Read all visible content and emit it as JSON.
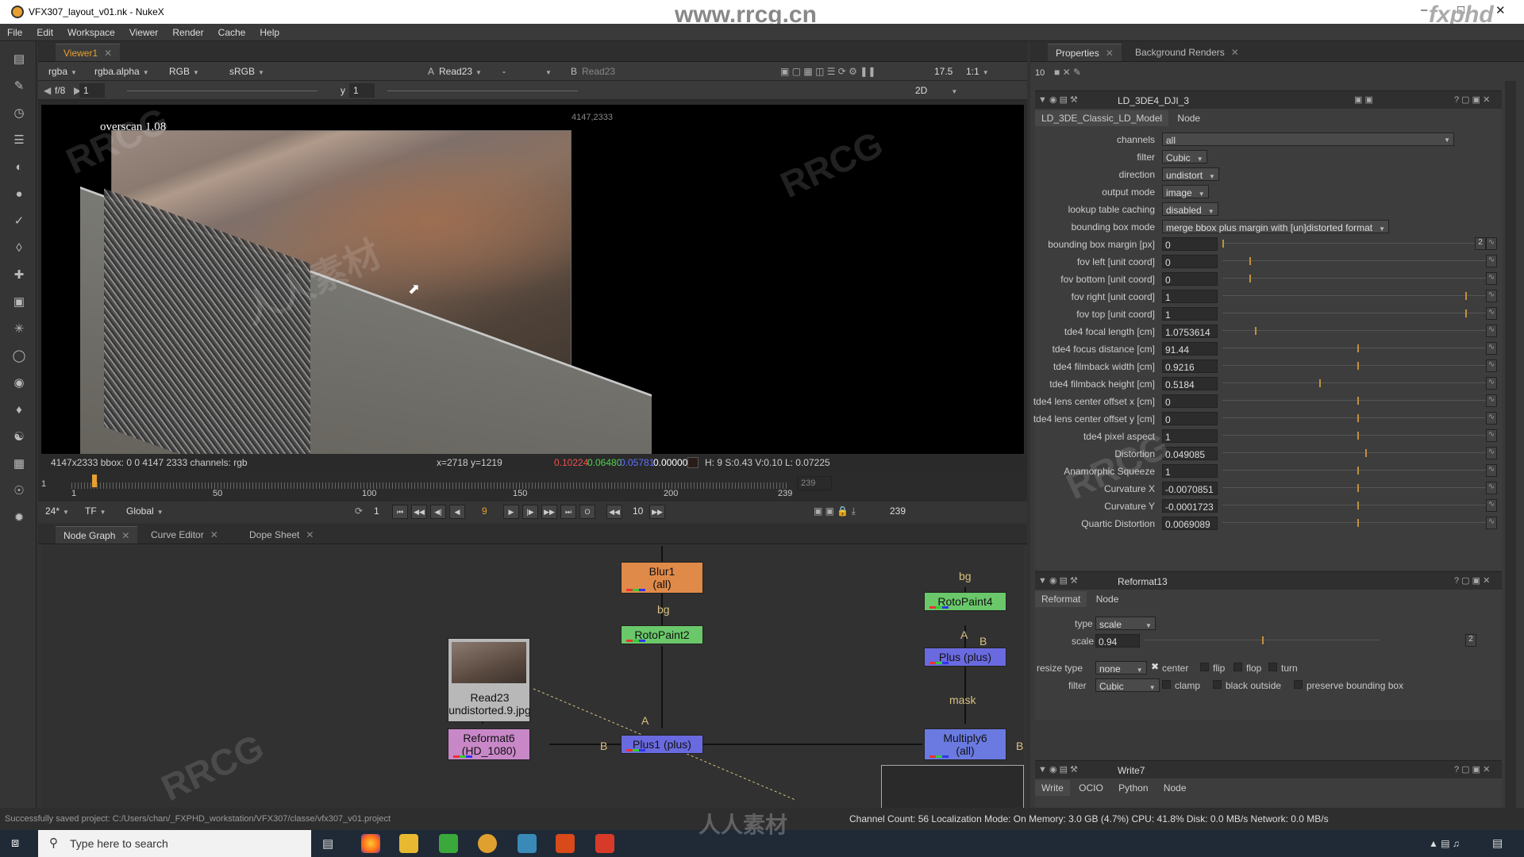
{
  "window": {
    "title": "VFX307_layout_v01.nk - NukeX"
  },
  "menu": [
    "File",
    "Edit",
    "Workspace",
    "Viewer",
    "Render",
    "Cache",
    "Help"
  ],
  "viewer": {
    "tab": "Viewer1",
    "channels": "rgba",
    "alpha": "rgba.alpha",
    "display": "RGB",
    "lut": "sRGB",
    "input_a_label": "A",
    "input_a": "Read23",
    "wipe": "-",
    "input_b_label": "B",
    "input_b": "Read23",
    "fstop": "f/8",
    "frame_field": "1",
    "y_label": "y",
    "y_field": "1",
    "zoom": "17.5",
    "ratio": "1:1",
    "mode2d": "2D",
    "overscan_text": "overscan 1.08",
    "bbox_corner": "4147,2333",
    "info_format": "4147x2333  bbox: 0 0 4147 2333 channels: rgb",
    "info_coords": "x=2718 y=1219",
    "info_r": "0.10224",
    "info_g": "0.06480",
    "info_b": "0.05781",
    "info_a": "0.00000",
    "info_hsvl": "H:  9 S:0.43 V:0.10  L: 0.07225",
    "tl_labels": [
      "1",
      "50",
      "100",
      "150",
      "200",
      "239"
    ],
    "tl_start": "1",
    "tl_end_box": "239",
    "fps": "24*",
    "tf": "TF",
    "global": "Global",
    "play_in": "1",
    "current_frame": "9",
    "step": "10",
    "play_out": "239"
  },
  "nodegraph": {
    "tabs": [
      "Node Graph",
      "Curve Editor",
      "Dope Sheet"
    ],
    "nodes": {
      "blur1": "Blur1",
      "blur1_sub": "(all)",
      "roto2": "RotoPaint2",
      "roto4": "RotoPaint4",
      "read23": "Read23",
      "read23_sub": "undistorted.9.jpg",
      "reformat6": "Reformat6",
      "reformat6_sub": "(HD_1080)",
      "plus1": "Plus1 (plus)",
      "plus": "Plus (plus)",
      "multiply6": "Multiply6",
      "multiply6_sub": "(all)"
    },
    "edge_labels": {
      "bg1": "bg",
      "bg2": "bg",
      "a1": "A",
      "a2": "A",
      "b1": "B",
      "b2": "B",
      "b3": "B",
      "mask": "mask"
    }
  },
  "properties": {
    "tabs": [
      "Properties",
      "Background Renders"
    ],
    "max_panels": "10",
    "ld": {
      "name": "LD_3DE4_DJI_3",
      "subtabs": [
        "LD_3DE_Classic_LD_Model",
        "Node"
      ],
      "rows": [
        {
          "label": "channels",
          "value": "all",
          "kind": "dd_wide"
        },
        {
          "label": "filter",
          "value": "Cubic",
          "kind": "dd"
        },
        {
          "label": "direction",
          "value": "undistort",
          "kind": "dd"
        },
        {
          "label": "output mode",
          "value": "image",
          "kind": "dd"
        },
        {
          "label": "lookup table caching",
          "value": "disabled",
          "kind": "dd"
        },
        {
          "label": "bounding box mode",
          "value": "merge bbox plus margin with [un]distorted format",
          "kind": "dd"
        },
        {
          "label": "bounding box margin [px]",
          "value": "0",
          "kind": "num",
          "knob": 0.0
        },
        {
          "label": "fov left [unit coord]",
          "value": "0",
          "kind": "num",
          "knob": 0.1
        },
        {
          "label": "fov bottom [unit coord]",
          "value": "0",
          "kind": "num",
          "knob": 0.1
        },
        {
          "label": "fov right [unit coord]",
          "value": "1",
          "kind": "num",
          "knob": 0.9
        },
        {
          "label": "fov top [unit coord]",
          "value": "1",
          "kind": "num",
          "knob": 0.9
        },
        {
          "label": "tde4 focal length [cm]",
          "value": "1.0753614",
          "kind": "num",
          "knob": 0.12
        },
        {
          "label": "tde4 focus distance [cm]",
          "value": "91.44",
          "kind": "num",
          "knob": 0.5
        },
        {
          "label": "tde4 filmback width [cm]",
          "value": "0.9216",
          "kind": "num",
          "knob": 0.5
        },
        {
          "label": "tde4 filmback height [cm]",
          "value": "0.5184",
          "kind": "num",
          "knob": 0.36
        },
        {
          "label": "tde4 lens center offset x [cm]",
          "value": "0",
          "kind": "num",
          "knob": 0.5
        },
        {
          "label": "tde4 lens center offset y [cm]",
          "value": "0",
          "kind": "num",
          "knob": 0.5
        },
        {
          "label": "tde4 pixel aspect",
          "value": "1",
          "kind": "num",
          "knob": 0.5
        },
        {
          "label": "Distortion",
          "value": "0.049085",
          "kind": "num",
          "knob": 0.53
        },
        {
          "label": "Anamorphic Squeeze",
          "value": "1",
          "kind": "num",
          "knob": 0.5
        },
        {
          "label": "Curvature X",
          "value": "-0.0070851",
          "kind": "num",
          "knob": 0.5
        },
        {
          "label": "Curvature Y",
          "value": "-0.0001723",
          "kind": "num",
          "knob": 0.5
        },
        {
          "label": "Quartic Distortion",
          "value": "0.0069089",
          "kind": "num",
          "knob": 0.5
        }
      ],
      "margin_box": "2"
    },
    "reformat": {
      "name": "Reformat13",
      "subtabs": [
        "Reformat",
        "Node"
      ],
      "type_label": "type",
      "type_value": "scale",
      "scale_label": "scale",
      "scale_value": "0.94",
      "scale_box": "2",
      "resize_label": "resize type",
      "resize_value": "none",
      "center": "center",
      "flip": "flip",
      "flop": "flop",
      "turn": "turn",
      "filter_label": "filter",
      "filter_value": "Cubic",
      "clamp": "clamp",
      "black_outside": "black outside",
      "preserve": "preserve bounding box"
    },
    "write": {
      "name": "Write7",
      "subtabs": [
        "Write",
        "OCIO",
        "Python",
        "Node"
      ]
    }
  },
  "status": {
    "left": "Successfully saved project: C:/Users/chan/_FXPHD_workstation/VFX307/classe/vfx307_v01.project",
    "right": "Channel Count: 56  Localization Mode: On  Memory: 3.0 GB (4.7%)  CPU: 41.8%  Disk: 0.0 MB/s  Network: 0.0 MB/s"
  },
  "taskbar": {
    "search_placeholder": "Type here to search"
  },
  "watermark": {
    "url": "www.rrcg.cn",
    "brand": "fxphd",
    "text": "RRCG",
    "cn": "人人素材"
  }
}
